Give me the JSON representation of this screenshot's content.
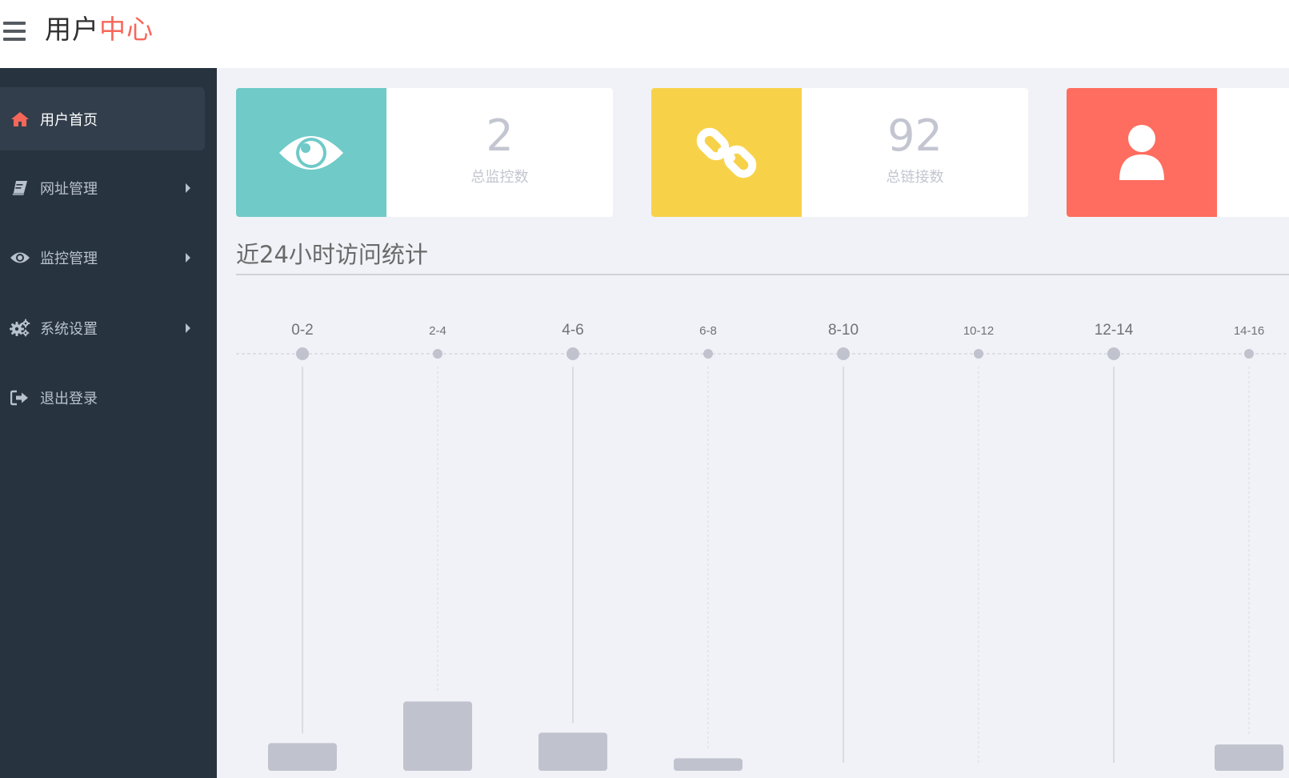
{
  "header": {
    "title_main": "用户",
    "title_accent": "中心",
    "accent_color": "#f6675a",
    "menu_icon": "hamburger-icon"
  },
  "sidebar": {
    "background": "#283340",
    "items": [
      {
        "label": "用户首页",
        "icon": "home-icon",
        "active": true,
        "has_submenu": false
      },
      {
        "label": "网址管理",
        "icon": "book-icon",
        "active": false,
        "has_submenu": true
      },
      {
        "label": "监控管理",
        "icon": "eye-icon",
        "active": false,
        "has_submenu": true
      },
      {
        "label": "系统设置",
        "icon": "gears-icon",
        "active": false,
        "has_submenu": true
      },
      {
        "label": "退出登录",
        "icon": "sign-out-icon",
        "active": false,
        "has_submenu": false
      }
    ]
  },
  "cards": [
    {
      "value": "2",
      "label": "总监控数",
      "icon": "eye-icon",
      "color": "#6fcac8"
    },
    {
      "value": "92",
      "label": "总链接数",
      "icon": "link-icon",
      "color": "#f7d249"
    },
    {
      "value": "",
      "label": "",
      "icon": "user-icon",
      "color": "#fe6d5f"
    }
  ],
  "section": {
    "title": "近24小时访问统计"
  },
  "chart_data": {
    "type": "bar",
    "categories": [
      "0-2",
      "2-4",
      "4-6",
      "6-8",
      "8-10",
      "10-12",
      "12-14",
      "14-16"
    ],
    "values": [
      4,
      10,
      5.5,
      1.8,
      0,
      0,
      0,
      3.8
    ],
    "ylim": [
      0,
      60
    ],
    "bar_color": "#c0c2cd",
    "grid": false
  }
}
